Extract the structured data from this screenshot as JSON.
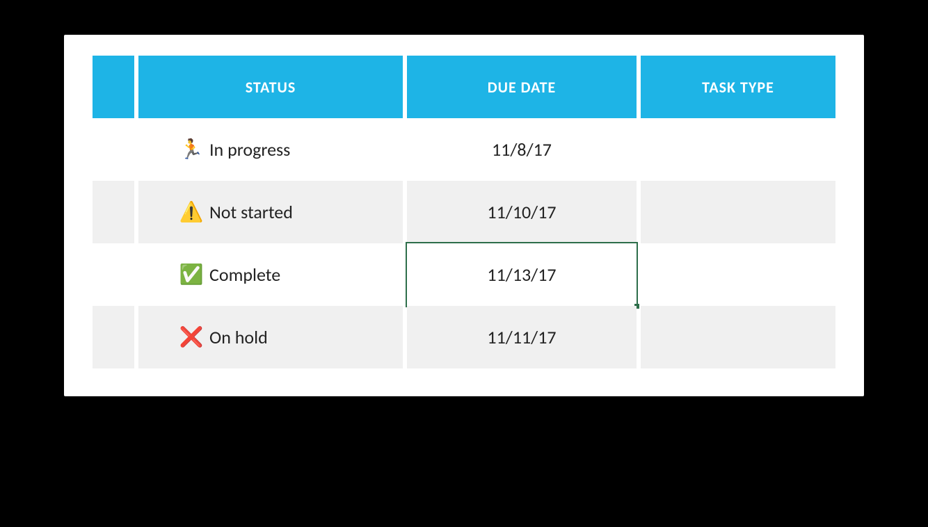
{
  "columns": {
    "status": "STATUS",
    "due_date": "DUE DATE",
    "task_type": "TASK TYPE"
  },
  "rows": [
    {
      "icon": "🏃",
      "icon_name": "running-icon",
      "status": "In progress",
      "due_date": "11/8/17",
      "task_type": "",
      "selected_col": null
    },
    {
      "icon": "⚠️",
      "icon_name": "warning-icon",
      "status": "Not started",
      "due_date": "11/10/17",
      "task_type": "",
      "selected_col": null
    },
    {
      "icon": "✅",
      "icon_name": "check-icon",
      "status": "Complete",
      "due_date": "11/13/17",
      "task_type": "",
      "selected_col": "due_date"
    },
    {
      "icon": "❌",
      "icon_name": "cross-icon",
      "status": "On hold",
      "due_date": "11/11/17",
      "task_type": "",
      "selected_col": null
    }
  ],
  "colors": {
    "header_bg": "#1eb4e6",
    "selection_border": "#2d6e4a"
  }
}
